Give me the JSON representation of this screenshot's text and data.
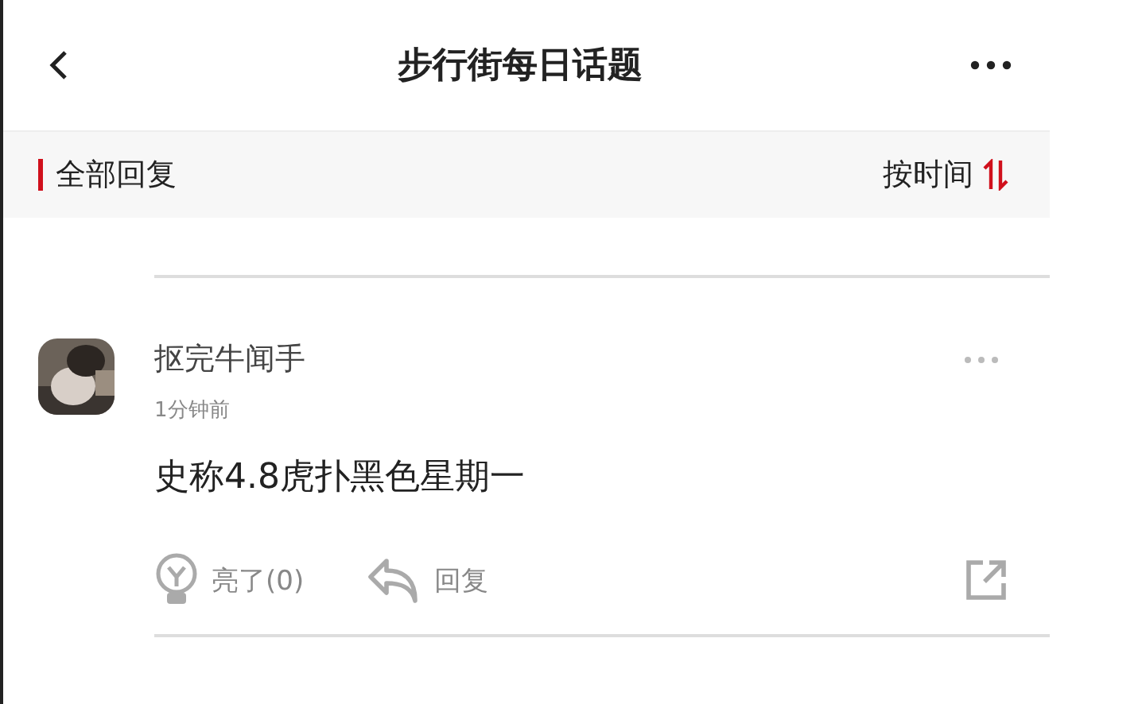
{
  "header": {
    "title": "步行街每日话题"
  },
  "filter_bar": {
    "label": "全部回复",
    "sort": "按时间"
  },
  "comments": [
    {
      "author": "抠完牛闻手",
      "time": "1分钟前",
      "text": "史称4.8虎扑黑色星期一",
      "light_label": "亮了(0)",
      "reply_label": "回复"
    }
  ]
}
